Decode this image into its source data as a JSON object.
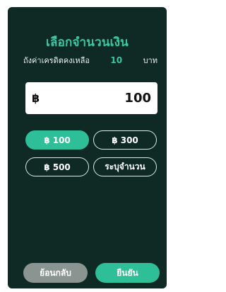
{
  "dialog": {
    "title": "เลือกจำนวนเงิน",
    "subtitle": {
      "left": "ถังค่าเครดิตคงเหลือ",
      "balance": "10",
      "unit": "บาท"
    },
    "amount": {
      "symbol": "฿",
      "value": "100"
    },
    "options": [
      {
        "label": "฿ 100",
        "selected": true
      },
      {
        "label": "฿ 300",
        "selected": false
      },
      {
        "label": "฿ 500",
        "selected": false
      },
      {
        "label": "ระบุจำนวน",
        "selected": false
      }
    ],
    "buttons": {
      "back": "ย้อนกลับ",
      "confirm": "ยืนยัน"
    },
    "colors": {
      "background": "#0f2a25",
      "accent": "#2fbf98",
      "title": "#3ac7a2",
      "back_button": "#8a9591"
    }
  }
}
